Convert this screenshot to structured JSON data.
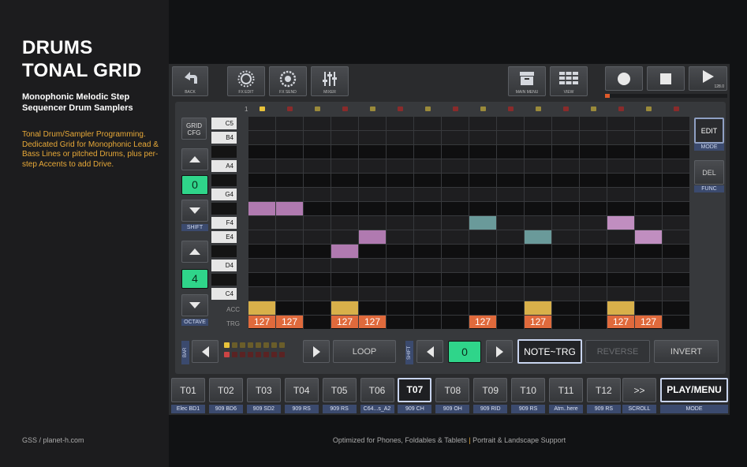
{
  "left_panel": {
    "title": "DRUMS\nTONAL GRID",
    "subtitle": "Monophonic Melodic Step Sequencer Drum Samplers",
    "description": "Tonal Drum/Sampler Programming. Dedicated Grid for Monophonic Lead & Bass Lines or pitched Drums, plus per-step Accents to add Drive.",
    "footer": "GSS / planet-h.com"
  },
  "bottom_footer": {
    "left": "Optimized for Phones, Foldables & Tablets",
    "sep": " | ",
    "right": "Portrait & Landscape Support"
  },
  "toolbar": {
    "back": "BACK",
    "fx_edit": "FX EDIT",
    "fx_send": "FX SEND",
    "mixer": "MIXER",
    "main_menu": "MAIN MENU",
    "view": "VIEW",
    "tempo": "128.0"
  },
  "grid": {
    "step_one": "1",
    "notes": [
      "C5",
      "B4",
      "",
      "A4",
      "",
      "G4",
      "",
      "F4",
      "E4",
      "",
      "D4",
      "",
      "C4"
    ],
    "acc_label": "ACC",
    "trg_label": "TRG",
    "grid_cfg": "GRID\nCFG",
    "shift_value": "0",
    "shift_label": "SHIFT",
    "octave_value": "4",
    "octave_label": "OCTAVE",
    "edit": "EDIT",
    "mode": "MODE",
    "del": "DEL",
    "func": "FUNC",
    "note_events": [
      {
        "step": 1,
        "row": 6,
        "color": "#b07ab0"
      },
      {
        "step": 2,
        "row": 6,
        "color": "#b07ab0"
      },
      {
        "step": 5,
        "row": 8,
        "color": "#b07ab0"
      },
      {
        "step": 4,
        "row": 9,
        "color": "#b07ab0"
      },
      {
        "step": 9,
        "row": 7,
        "color": "#6a9a9a"
      },
      {
        "step": 11,
        "row": 8,
        "color": "#6a9a9a"
      },
      {
        "step": 14,
        "row": 7,
        "color": "#c08ec0"
      },
      {
        "step": 15,
        "row": 8,
        "color": "#c08ec0"
      }
    ],
    "accents": [
      1,
      4,
      11,
      14
    ],
    "triggers": [
      {
        "step": 1,
        "value": "127"
      },
      {
        "step": 2,
        "value": "127"
      },
      {
        "step": 4,
        "value": "127"
      },
      {
        "step": 5,
        "value": "127"
      },
      {
        "step": 9,
        "value": "127"
      },
      {
        "step": 11,
        "value": "127"
      },
      {
        "step": 14,
        "value": "127"
      },
      {
        "step": 15,
        "value": "127"
      }
    ]
  },
  "controls": {
    "bar_label": "BAR",
    "loop": "LOOP",
    "shift_label": "SHIFT",
    "shift_value": "0",
    "note_trg": "NOTE~TRG",
    "reverse": "REVERSE",
    "invert": "INVERT"
  },
  "tracks": [
    {
      "id": "T01",
      "label": "Elec BD1"
    },
    {
      "id": "T02",
      "label": "909 BD6"
    },
    {
      "id": "T03",
      "label": "909 SD2"
    },
    {
      "id": "T04",
      "label": "909 RS"
    },
    {
      "id": "T05",
      "label": "909 RS"
    },
    {
      "id": "T06",
      "label": "C64...s_A2"
    },
    {
      "id": "T07",
      "label": "909 CH",
      "selected": true
    },
    {
      "id": "T08",
      "label": "909 OH"
    },
    {
      "id": "T09",
      "label": "909 RID"
    },
    {
      "id": "T10",
      "label": "909 RS"
    },
    {
      "id": "T11",
      "label": "Atm..here"
    },
    {
      "id": "T12",
      "label": "909 RS"
    }
  ],
  "scroll": {
    "button": ">>",
    "label": "SCROLL"
  },
  "play_menu": {
    "button": "PLAY/MENU",
    "label": "MODE"
  },
  "colors": {
    "accent_orange": "#e8a938",
    "trigger": "#e06a3c",
    "value_green": "#2fd58a",
    "label_blue": "#3b4a6e"
  }
}
